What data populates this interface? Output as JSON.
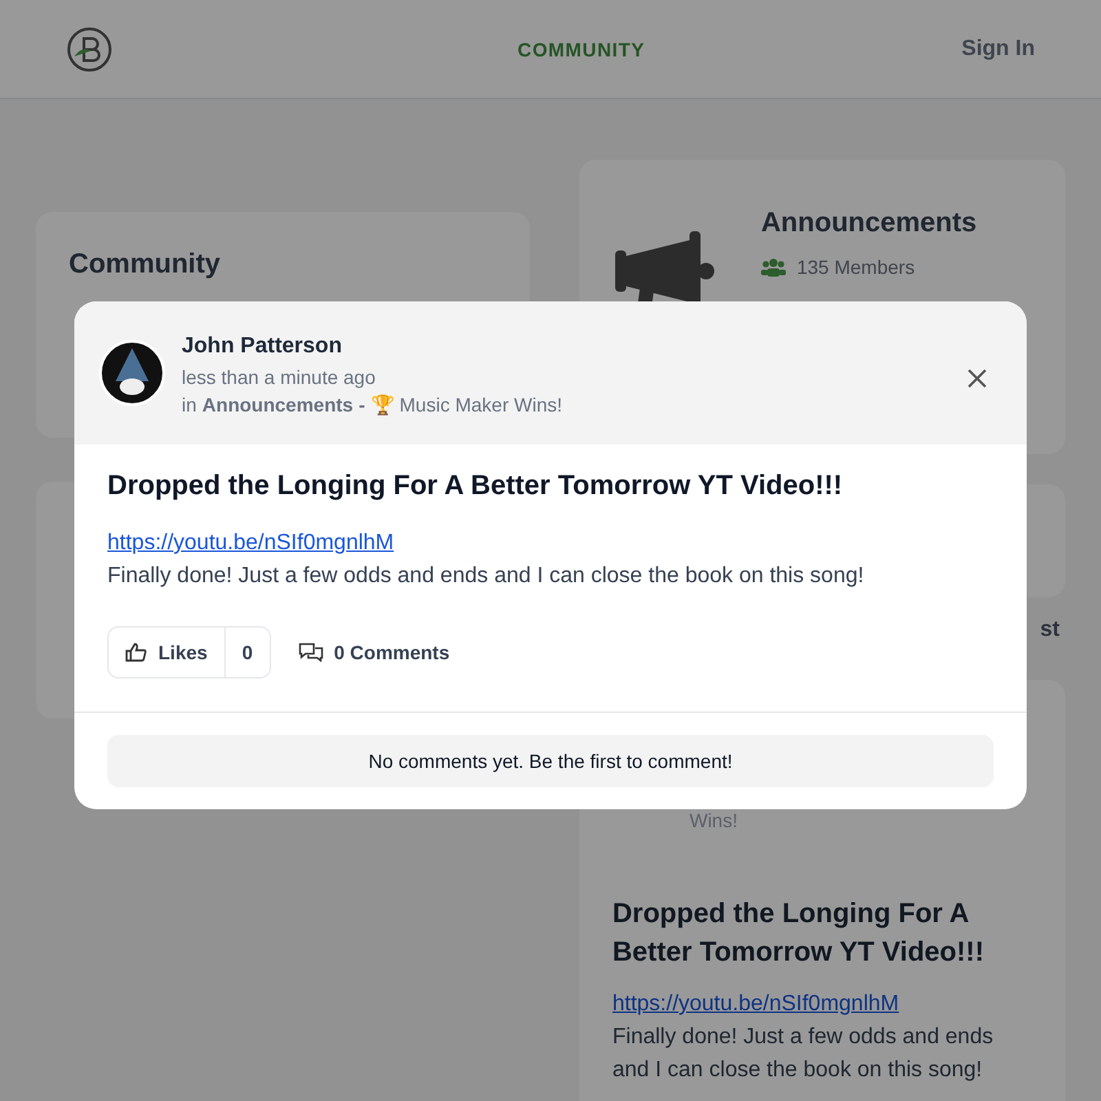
{
  "header": {
    "nav": "COMMUNITY",
    "sign_in": "Sign In"
  },
  "background": {
    "community_card": {
      "title": "Community"
    },
    "group_card": {
      "title": "Announcements",
      "members": "135 Members"
    },
    "partial_label": "st",
    "post": {
      "meta_fragment": "Wins!",
      "title": "Dropped the Longing For A Better Tomorrow YT Video!!!",
      "link": "https://youtu.be/nSIf0mgnlhM",
      "body": "Finally done! Just a few odds and ends and I can close the book on this song!"
    }
  },
  "modal": {
    "author": "John Patterson",
    "time": "less than a minute ago",
    "in_prefix": "in",
    "group": "Announcements",
    "separator": "-",
    "trophy": "🏆",
    "topic": "Music Maker Wins!",
    "title": "Dropped the Longing For A Better Tomorrow YT Video!!!",
    "link": "https://youtu.be/nSIf0mgnlhM",
    "body": "Finally done! Just a few odds and ends and I can close the book on this song!",
    "likes_label": "Likes",
    "likes_count": "0",
    "comments": "0 Comments",
    "empty_comments": "No comments yet. Be the first to comment!"
  }
}
